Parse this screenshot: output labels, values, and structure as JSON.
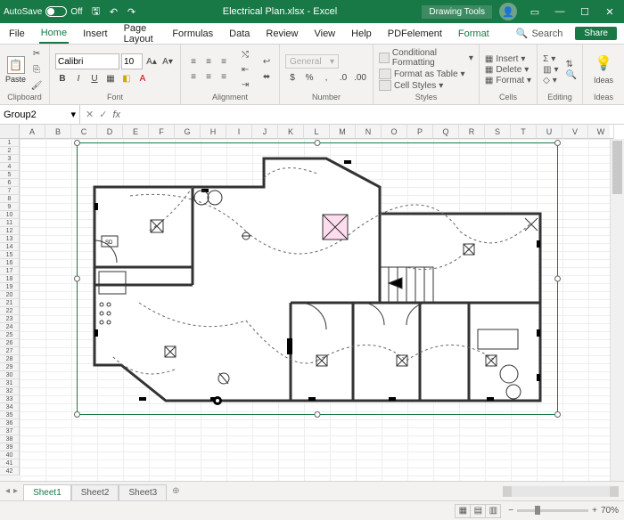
{
  "titlebar": {
    "autosave_label": "AutoSave",
    "autosave_state": "Off",
    "filename": "Electrical Plan.xlsx - Excel",
    "context_tab": "Drawing Tools"
  },
  "tabs": {
    "file": "File",
    "home": "Home",
    "insert": "Insert",
    "page_layout": "Page Layout",
    "formulas": "Formulas",
    "data": "Data",
    "review": "Review",
    "view": "View",
    "help": "Help",
    "pdfelement": "PDFelement",
    "format": "Format",
    "search": "Search",
    "share": "Share"
  },
  "ribbon": {
    "clipboard": {
      "paste": "Paste",
      "label": "Clipboard"
    },
    "font": {
      "name": "Calibri",
      "size": "10",
      "label": "Font"
    },
    "alignment": {
      "label": "Alignment"
    },
    "number": {
      "combo": "General",
      "label": "Number"
    },
    "styles": {
      "cond": "Conditional Formatting",
      "table": "Format as Table",
      "cell": "Cell Styles",
      "label": "Styles"
    },
    "cells": {
      "insert": "Insert",
      "delete": "Delete",
      "format": "Format",
      "label": "Cells"
    },
    "editing": {
      "label": "Editing"
    },
    "ideas": {
      "label": "Ideas"
    }
  },
  "namebox": "Group2",
  "columns": [
    "A",
    "B",
    "C",
    "D",
    "E",
    "F",
    "G",
    "H",
    "I",
    "J",
    "K",
    "L",
    "M",
    "N",
    "O",
    "P",
    "Q",
    "R",
    "S",
    "T",
    "U",
    "V",
    "W"
  ],
  "rows_count": 42,
  "sheets": {
    "s1": "Sheet1",
    "s2": "Sheet2",
    "s3": "Sheet3"
  },
  "status": {
    "zoom": "70%"
  },
  "floorplan": {
    "sd_label": "SD"
  }
}
